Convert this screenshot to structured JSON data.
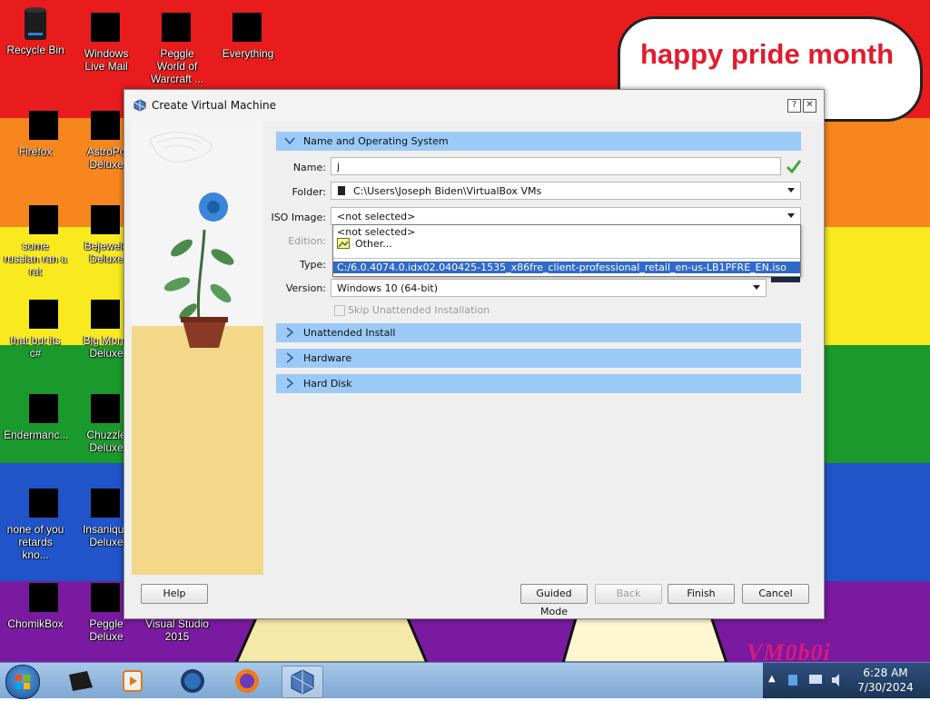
{
  "wallpaper": {
    "bubble_text": "happy pride month",
    "corner_text": "VM0b0i"
  },
  "desktop_icons": [
    {
      "label": "Recycle Bin",
      "icon": "recycle-bin-icon"
    },
    {
      "label": "Windows Live Mail",
      "icon": "mail-icon"
    },
    {
      "label": "Peggle World of Warcraft ...",
      "icon": "peggle-icon"
    },
    {
      "label": "Everything",
      "icon": "search-icon"
    },
    {
      "label": "Firefox",
      "icon": "firefox-icon"
    },
    {
      "label": "AstroPo Deluxe",
      "icon": "game-icon"
    },
    {
      "label": "some russian ran a rat",
      "icon": "app-icon"
    },
    {
      "label": "Bejewele Deluxe",
      "icon": "gem-icon"
    },
    {
      "label": "that but its c#",
      "icon": "folder-icon"
    },
    {
      "label": "Big Mone Deluxe",
      "icon": "money-bag-icon"
    },
    {
      "label": "Endermanc...",
      "icon": "app-icon"
    },
    {
      "label": "Chuzzle Deluxe",
      "icon": "game-icon"
    },
    {
      "label": "none of you retards kno...",
      "icon": "app-icon"
    },
    {
      "label": "Insaniqua Deluxe",
      "icon": "game-icon"
    },
    {
      "label": "ChomikBox",
      "icon": "hamster-icon"
    },
    {
      "label": "Peggle Deluxe",
      "icon": "peggle-icon"
    },
    {
      "label": "Visual Studio 2015",
      "icon": "visual-studio-icon"
    }
  ],
  "dialog": {
    "title": "Create Virtual Machine",
    "help_glyph": "?",
    "close_glyph": "✕",
    "sections": {
      "name_os": "Name and Operating System",
      "unattended": "Unattended Install",
      "hardware": "Hardware",
      "hard_disk": "Hard Disk"
    },
    "fields": {
      "name_label": "Name:",
      "name_value": "j",
      "folder_label": "Folder:",
      "folder_value": "C:\\Users\\Joseph Biden\\VirtualBox VMs",
      "iso_label": "ISO Image:",
      "iso_value": "<not selected>",
      "edition_label": "Edition:",
      "type_label": "Type:",
      "version_label": "Version:",
      "version_value": "Windows 10 (64-bit)",
      "skip_label": "Skip Unattended Installation"
    },
    "iso_options": [
      "<not selected>",
      "Other...",
      "C:/6.0.4074.0.idx02.040425-1535_x86fre_client-professional_retail_en-us-LB1PFRE_EN.iso"
    ],
    "os_badge": "10",
    "buttons": {
      "help": "Help",
      "guided": "Guided Mode",
      "back": "Back",
      "finish": "Finish",
      "cancel": "Cancel"
    }
  },
  "taskbar": {
    "time": "6:28 AM",
    "date": "7/30/2024",
    "tray_arrow": "▲"
  }
}
